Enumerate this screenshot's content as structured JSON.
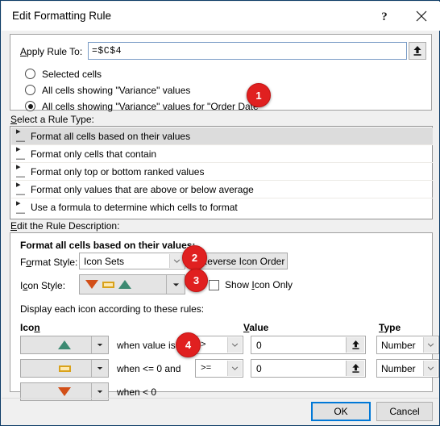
{
  "window": {
    "title": "Edit Formatting Rule",
    "help_icon": "question-mark-icon",
    "close_icon": "close-icon"
  },
  "apply_rule_to": {
    "label": "Apply Rule To:",
    "value": "=$C$4",
    "collapse_icon": "collapse-dialog-icon",
    "options": [
      {
        "label": "Selected cells",
        "selected": false
      },
      {
        "label": "All cells showing \"Variance\" values",
        "selected": false
      },
      {
        "label": "All cells showing \"Variance\" values for \"Order Date\"",
        "selected": true
      }
    ]
  },
  "rule_type": {
    "label": "Select a Rule Type:",
    "items": [
      {
        "label": "Format all cells based on their values",
        "selected": true
      },
      {
        "label": "Format only cells that contain",
        "selected": false
      },
      {
        "label": "Format only top or bottom ranked values",
        "selected": false
      },
      {
        "label": "Format only values that are above or below average",
        "selected": false
      },
      {
        "label": "Use a formula to determine which cells to format",
        "selected": false
      }
    ],
    "bullet": "┐"
  },
  "rule_description": {
    "label": "Edit the Rule Description:",
    "heading": "Format all cells based on their values:",
    "format_style_label": "Format Style:",
    "format_style_value": "Icon Sets",
    "icon_style_label": "Icon Style:",
    "icon_style_icons": [
      "triangle-down-red",
      "bar-yellow",
      "triangle-up-green"
    ],
    "reverse_icon_order_label": "Reverse Icon Order",
    "show_icon_only_label": "Show Icon Only",
    "show_icon_only_checked": false,
    "display_rules_label": "Display each icon according to these rules:",
    "columns": {
      "icon": "Icon",
      "value": "Value",
      "type": "Type"
    },
    "rows": [
      {
        "icon": "triangle-up-green",
        "when": "when value is",
        "operator": ">",
        "value": "0",
        "type": "Number"
      },
      {
        "icon": "bar-yellow",
        "when": "when <= 0 and",
        "operator": ">=",
        "value": "0",
        "type": "Number"
      },
      {
        "icon": "triangle-down-red",
        "when": "when < 0",
        "operator": "",
        "value": "",
        "type": ""
      }
    ]
  },
  "footer": {
    "ok_label": "OK",
    "cancel_label": "Cancel"
  },
  "annotations": [
    {
      "number": "1"
    },
    {
      "number": "2"
    },
    {
      "number": "3"
    },
    {
      "number": "4"
    }
  ],
  "colors": {
    "badge": "#e02020",
    "accent": "#0078d7",
    "icon_green": "#3c8a72",
    "icon_red": "#d24f18",
    "icon_yellow": "#d9a21b"
  }
}
